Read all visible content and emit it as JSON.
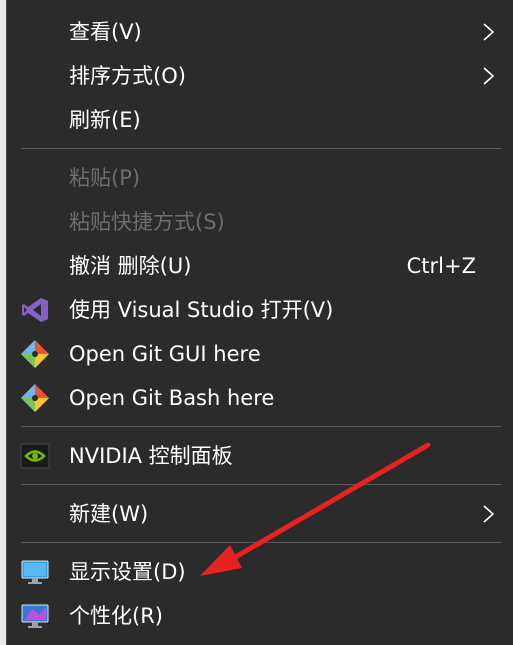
{
  "menu": {
    "items": [
      {
        "label": "查看(V)"
      },
      {
        "label": "排序方式(O)"
      },
      {
        "label": "刷新(E)"
      },
      {
        "label": "粘贴(P)"
      },
      {
        "label": "粘贴快捷方式(S)"
      },
      {
        "label": "撤消 删除(U)",
        "shortcut": "Ctrl+Z"
      },
      {
        "label": "使用 Visual Studio 打开(V)",
        "icon": "visual-studio-icon"
      },
      {
        "label": "Open Git GUI here",
        "icon": "git-icon"
      },
      {
        "label": "Open Git Bash here",
        "icon": "git-icon"
      },
      {
        "label": "NVIDIA 控制面板",
        "icon": "nvidia-icon"
      },
      {
        "label": "新建(W)"
      },
      {
        "label": "显示设置(D)",
        "icon": "display-settings-icon"
      },
      {
        "label": "个性化(R)",
        "icon": "personalize-icon"
      }
    ]
  },
  "colors": {
    "menu_bg": "#2b2b2b",
    "text": "#ffffff",
    "disabled_text": "#6d6d6d",
    "separator": "#5a5a5a",
    "annotation_arrow": "#e8231f"
  }
}
